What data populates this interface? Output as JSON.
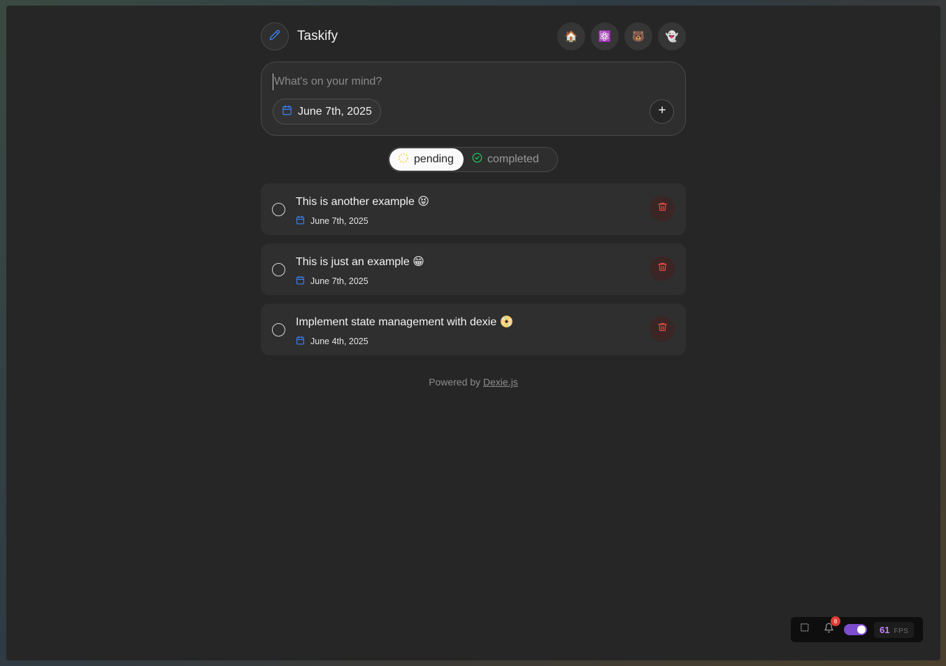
{
  "app": {
    "title": "Taskify"
  },
  "theme_buttons": [
    {
      "icon": "house-emoji",
      "glyph": "🏠"
    },
    {
      "icon": "atom-emoji",
      "glyph": "⚛️"
    },
    {
      "icon": "bear-emoji",
      "glyph": "🐻"
    },
    {
      "icon": "ghost-emoji",
      "glyph": "👻"
    }
  ],
  "composer": {
    "placeholder": "What's on your mind?",
    "value": "",
    "date": "June 7th, 2025"
  },
  "tabs": [
    {
      "label": "pending",
      "active": true
    },
    {
      "label": "completed",
      "active": false
    }
  ],
  "tasks": [
    {
      "title": "This is another example 😝",
      "date": "June 7th, 2025",
      "done": false
    },
    {
      "title": "This is just an example 😁",
      "date": "June 7th, 2025",
      "done": false
    },
    {
      "title": "Implement state management with dexie 📀",
      "date": "June 4th, 2025",
      "done": false
    }
  ],
  "footer": {
    "prefix": "Powered by ",
    "link": "Dexie.js"
  },
  "devtools": {
    "notification_count": "8",
    "fps": "61",
    "fps_label": "FPS"
  },
  "colors": {
    "accent_blue": "#3b82f6",
    "danger_red": "#ef4444",
    "success_green": "#22c55e",
    "pending_yellow": "#facc15",
    "fps_purple": "#c084fc"
  }
}
